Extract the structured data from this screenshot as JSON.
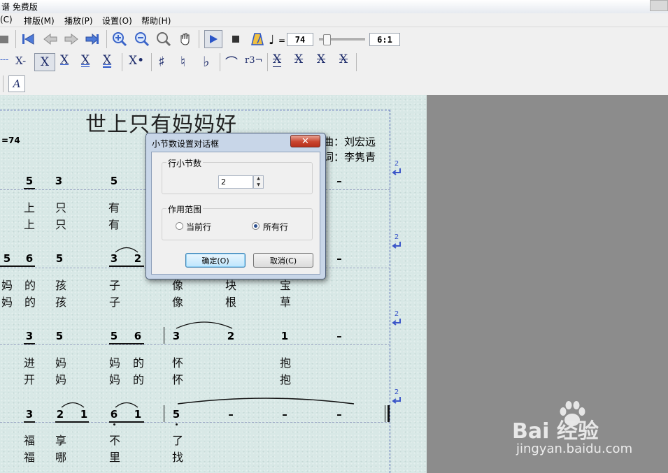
{
  "window": {
    "title": "谱 免费版"
  },
  "menu": [
    "(C)",
    "排版(M)",
    "播放(P)",
    "设置(O)",
    "帮助(H)"
  ],
  "toolbar1": {
    "tempo_equals": "=",
    "tempo_value": "74",
    "time_signature": "6:1",
    "tempo_slider_position": 0.15,
    "icons": [
      "open-icon",
      "first-page-icon",
      "prev-page-icon",
      "next-page-icon",
      "last-page-icon",
      "zoom-in-icon",
      "zoom-out-icon",
      "fit-page-icon",
      "hand-icon",
      "play-icon",
      "stop-icon",
      "metronome-icon",
      "quarter-note-icon"
    ]
  },
  "toolbar2": {
    "items": [
      "X-",
      "X",
      "X",
      "X",
      "X",
      "X•",
      "♯",
      "♮",
      "♭",
      "⌒",
      "r3¬",
      "X",
      "X",
      "X",
      "X"
    ]
  },
  "toolbar3": {
    "text_tool": "A"
  },
  "score": {
    "title": "世上只有妈妈好",
    "tempo": "=74",
    "composer": "曲：刘宏远",
    "lyricist": "词：李隽青",
    "return_mark_number": "2",
    "rows": [
      {
        "notes": [
          "5",
          "3",
          "5",
          "–"
        ],
        "lyrics1": [
          "上",
          "只",
          "有"
        ],
        "lyrics2": [
          "上",
          "只",
          "有"
        ]
      },
      {
        "notes": [
          "5",
          "6",
          "5",
          "3",
          "2",
          "–"
        ],
        "lyrics1": [
          "妈",
          "的",
          "孩",
          "子",
          "像",
          "块",
          "宝"
        ],
        "lyrics2": [
          "妈",
          "的",
          "孩",
          "子",
          "像",
          "根",
          "草"
        ]
      },
      {
        "notes": [
          "3",
          "5",
          "5",
          "6",
          "3",
          "2",
          "1",
          "–"
        ],
        "lyrics1": [
          "进",
          "妈",
          "妈",
          "的",
          "怀",
          "抱"
        ],
        "lyrics2": [
          "开",
          "妈",
          "妈",
          "的",
          "怀",
          "抱"
        ]
      },
      {
        "notes": [
          "3",
          "2",
          "1",
          "6",
          "1",
          "5",
          "–",
          "–",
          "–"
        ],
        "lyrics1": [
          "福",
          "享",
          "不",
          "了"
        ],
        "lyrics2": [
          "福",
          "哪",
          "里",
          "找"
        ]
      }
    ]
  },
  "dialog": {
    "title": "小节数设置对话框",
    "close_label": "✕",
    "group1_label": "行小节数",
    "measures_value": "2",
    "group2_label": "作用范围",
    "radio_current": "当前行",
    "radio_all": "所有行",
    "radio_selected": "所有行",
    "ok_label": "确定(O)",
    "cancel_label": "取消(C)"
  },
  "watermark": {
    "logo": "Bai  经验",
    "url": "jingyan.baidu.com"
  }
}
